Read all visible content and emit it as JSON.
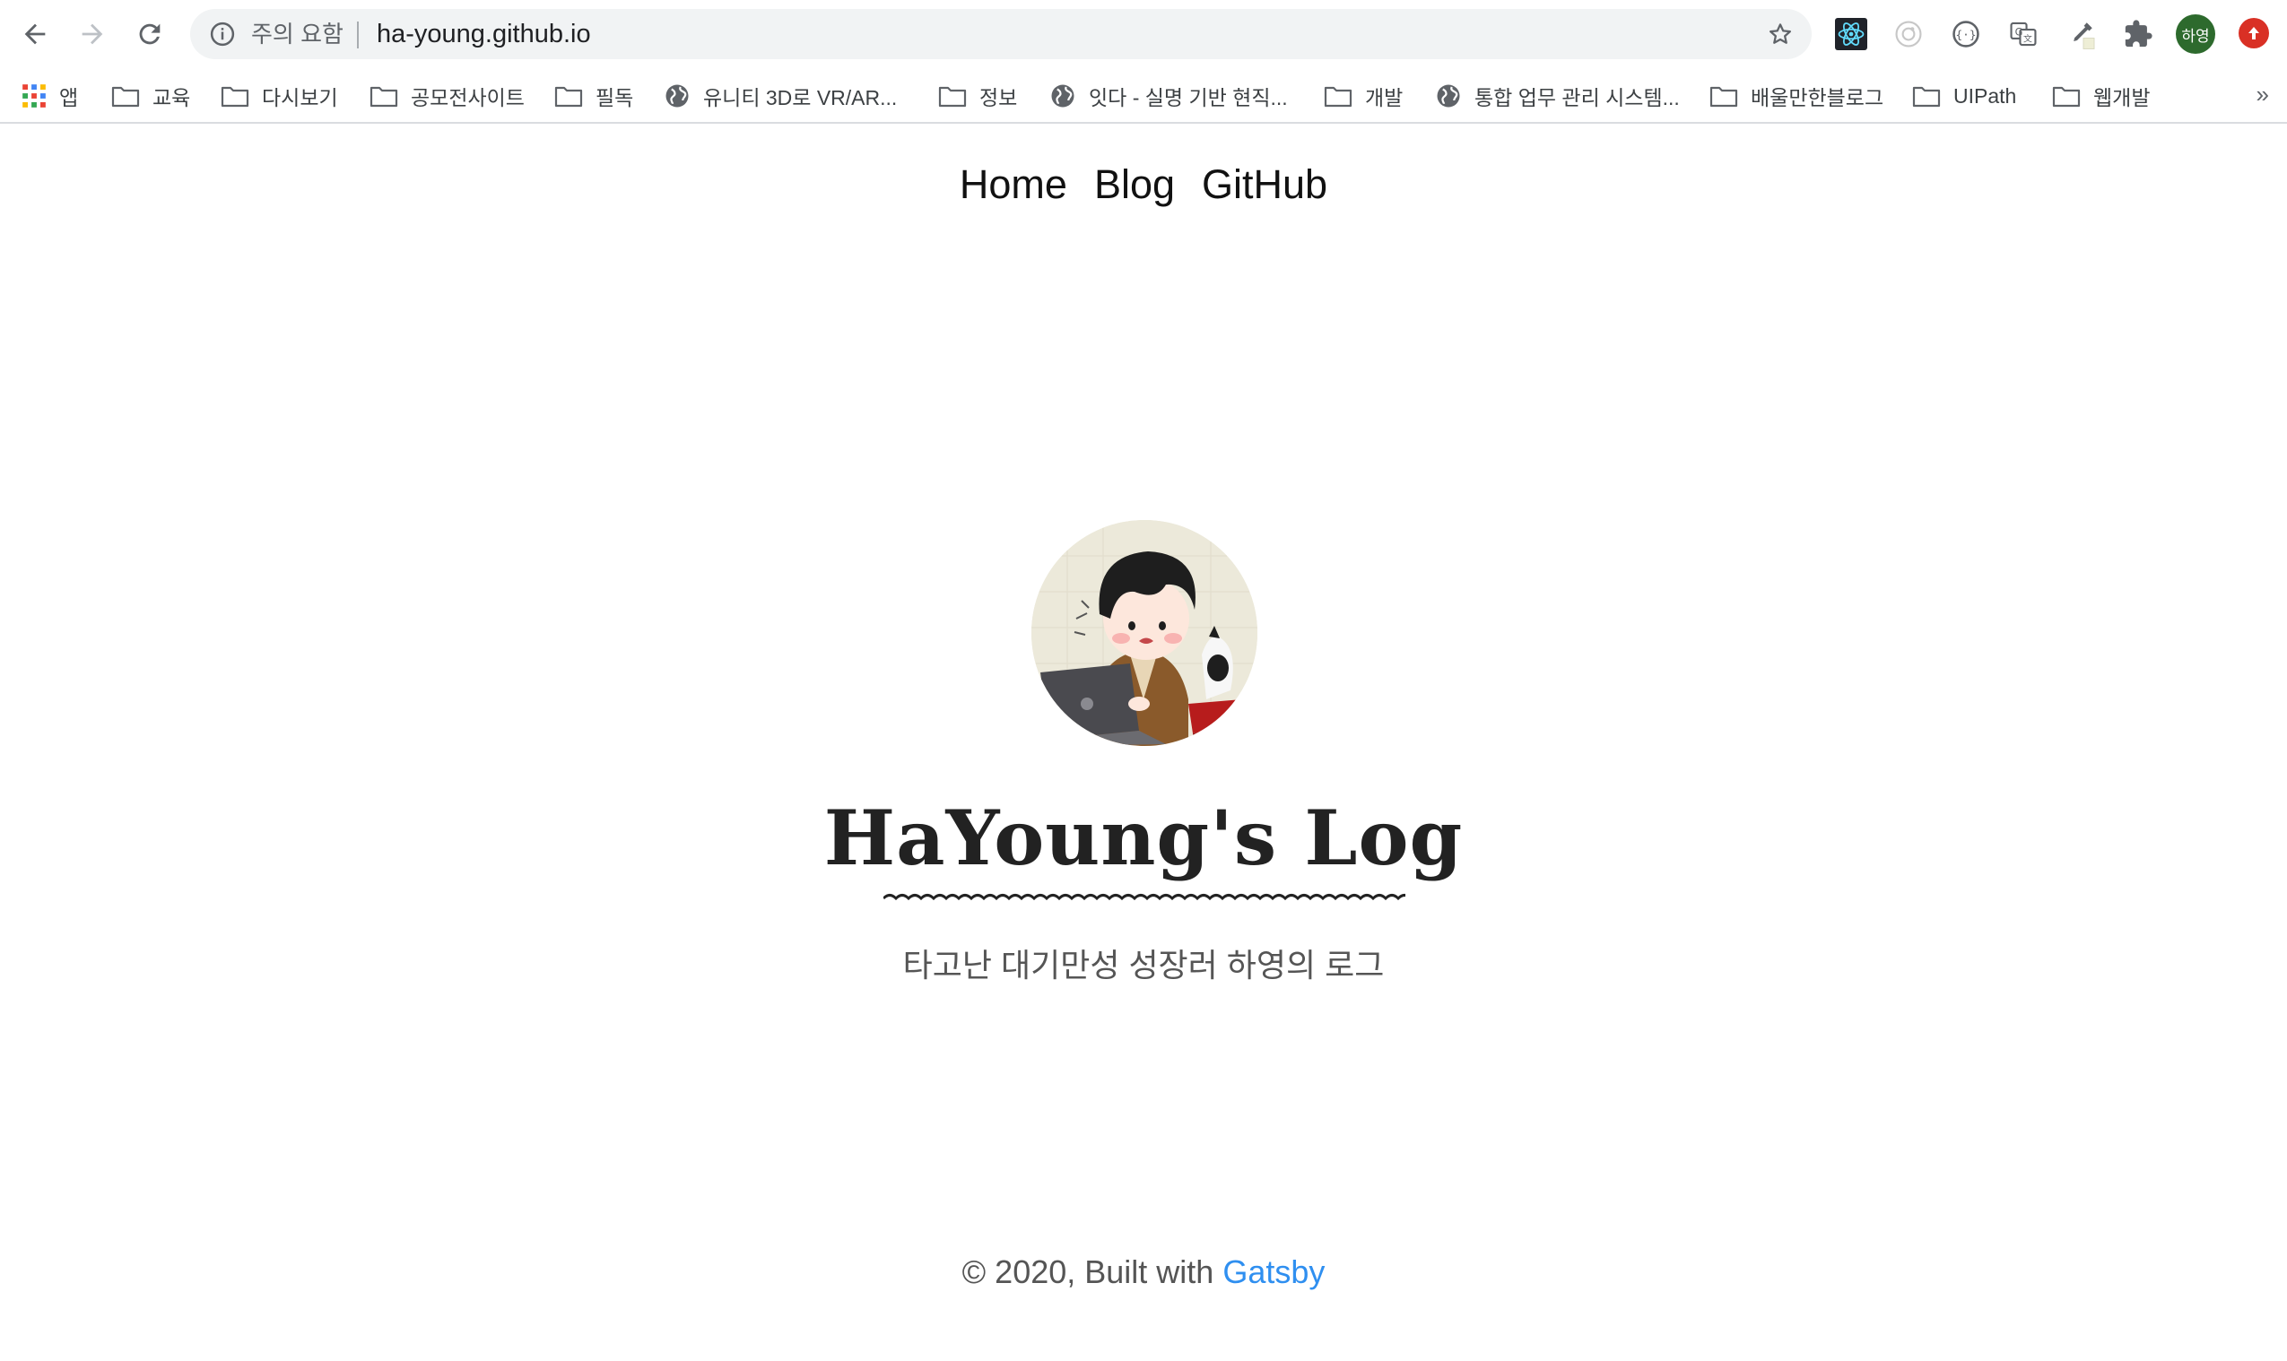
{
  "browser": {
    "omnibox": {
      "security_warning": "주의 요함",
      "url": "ha-young.github.io"
    },
    "profile": {
      "label": "하영",
      "color": "#2d6a2d"
    },
    "bookmarks": [
      {
        "label": "앱",
        "icon": "apps-icon"
      },
      {
        "label": "교육",
        "icon": "folder-icon"
      },
      {
        "label": "다시보기",
        "icon": "folder-icon"
      },
      {
        "label": "공모전사이트",
        "icon": "folder-icon"
      },
      {
        "label": "필독",
        "icon": "folder-icon"
      },
      {
        "label": "유니티 3D로 VR/AR...",
        "icon": "globe-icon"
      },
      {
        "label": "정보",
        "icon": "folder-icon"
      },
      {
        "label": "잇다 - 실명 기반 현직...",
        "icon": "globe-icon"
      },
      {
        "label": "개발",
        "icon": "folder-icon"
      },
      {
        "label": "통합 업무 관리 시스템...",
        "icon": "globe-icon"
      },
      {
        "label": "배울만한블로그",
        "icon": "folder-icon"
      },
      {
        "label": "UIPath",
        "icon": "folder-icon"
      },
      {
        "label": "웹개발",
        "icon": "folder-icon"
      }
    ],
    "bookmarks_overflow": "»"
  },
  "site": {
    "nav": {
      "home": "Home",
      "blog": "Blog",
      "github": "GitHub"
    },
    "title": "HaYoung's Log",
    "subtitle": "타고난 대기만성 성장러 하영의 로그",
    "footer": {
      "prefix": "© 2020, Built with ",
      "link": "Gatsby"
    },
    "link_color": "#2f8ff0"
  }
}
